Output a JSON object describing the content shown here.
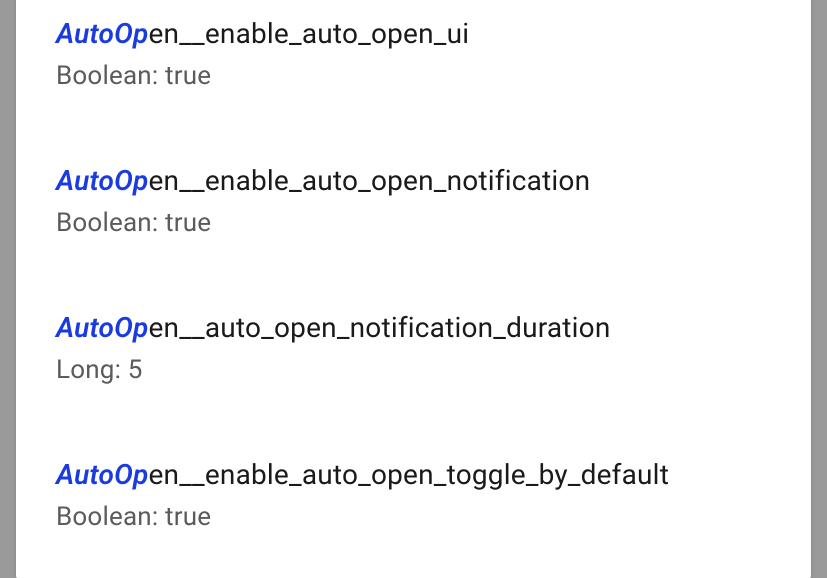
{
  "search_highlight": "AutoOp",
  "settings": [
    {
      "key_rest": "en__enable_auto_open_ui",
      "type_prefix": "Boolean: ",
      "value": "true"
    },
    {
      "key_rest": "en__enable_auto_open_notification",
      "type_prefix": "Boolean: ",
      "value": "true"
    },
    {
      "key_rest": "en__auto_open_notification_duration",
      "type_prefix": "Long: ",
      "value": "5"
    },
    {
      "key_rest": "en__enable_auto_open_toggle_by_default",
      "type_prefix": "Boolean: ",
      "value": "true"
    }
  ]
}
